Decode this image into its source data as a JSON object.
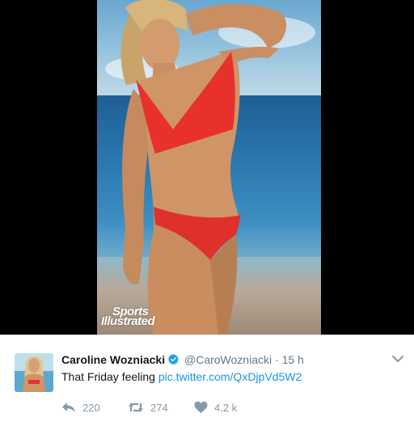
{
  "tweet": {
    "author_name": "Caroline Wozniacki",
    "handle": "@CaroWozniacki",
    "separator": "·",
    "time": "15 h",
    "text": "That Friday feeling ",
    "link": "pic.twitter.com/QxDjpVd5W2"
  },
  "media": {
    "watermark_line1": "Sports",
    "watermark_line2": "Illustrated"
  },
  "actions": {
    "reply_count": "220",
    "retweet_count": "274",
    "like_count": "4,2 k"
  },
  "colors": {
    "link": "#1b95e0",
    "verified": "#1da1f2",
    "muted": "#657786",
    "action_icon": "#8899a6",
    "swimsuit": "#e8302c"
  }
}
